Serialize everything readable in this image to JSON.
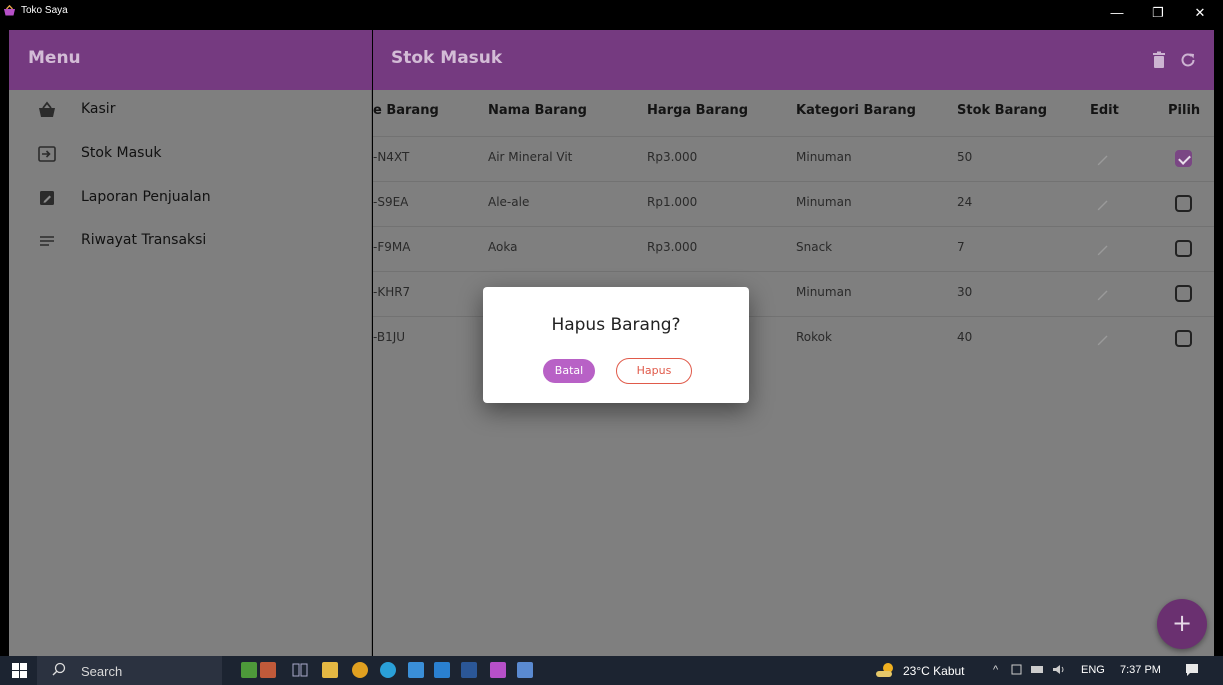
{
  "window": {
    "title": "Toko Saya",
    "minimize": "—",
    "maximize": "❐",
    "close": "✕"
  },
  "menu": {
    "title": "Menu",
    "items": [
      {
        "label": "Kasir",
        "icon": "basket-icon"
      },
      {
        "label": "Stok Masuk",
        "icon": "input-icon"
      },
      {
        "label": "Laporan Penjualan",
        "icon": "edit-note-icon"
      },
      {
        "label": "Riwayat Transaksi",
        "icon": "list-icon"
      }
    ]
  },
  "main": {
    "title": "Stok Masuk",
    "header_icons": [
      "trash-icon",
      "refresh-icon"
    ]
  },
  "table": {
    "columns": [
      "e Barang",
      "Nama Barang",
      "Harga Barang",
      "Kategori Barang",
      "Stok Barang",
      "Edit",
      "Pilih"
    ],
    "rows": [
      {
        "kode": "-N4XT",
        "nama": "Air Mineral Vit",
        "harga": "Rp3.000",
        "kategori": "Minuman",
        "stok": "50",
        "checked": true
      },
      {
        "kode": "-S9EA",
        "nama": "Ale-ale",
        "harga": "Rp1.000",
        "kategori": "Minuman",
        "stok": "24",
        "checked": false
      },
      {
        "kode": "-F9MA",
        "nama": "Aoka",
        "harga": "Rp3.000",
        "kategori": "Snack",
        "stok": "7",
        "checked": false
      },
      {
        "kode": "-KHR7",
        "nama": "",
        "harga": "",
        "kategori": "Minuman",
        "stok": "30",
        "checked": false
      },
      {
        "kode": "-B1JU",
        "nama": "",
        "harga": "",
        "kategori": "Rokok",
        "stok": "40",
        "checked": false
      }
    ]
  },
  "fab": {
    "label": "+"
  },
  "dialog": {
    "title": "Hapus Barang?",
    "cancel_label": "Batal",
    "confirm_label": "Hapus"
  },
  "taskbar": {
    "search_placeholder": "Search",
    "weather": "23°C  Kabut",
    "tray_chevron": "^",
    "language": "ENG",
    "time": "7:37 PM"
  },
  "colors": {
    "header": "#753a80",
    "overlay_bg": "#7f7f7f",
    "checkbox_on": "#7a4684",
    "batal_button": "#b861c6",
    "hapus_border": "#e05a4a",
    "fab": "#6a3070",
    "taskbar": "#1c2431"
  }
}
